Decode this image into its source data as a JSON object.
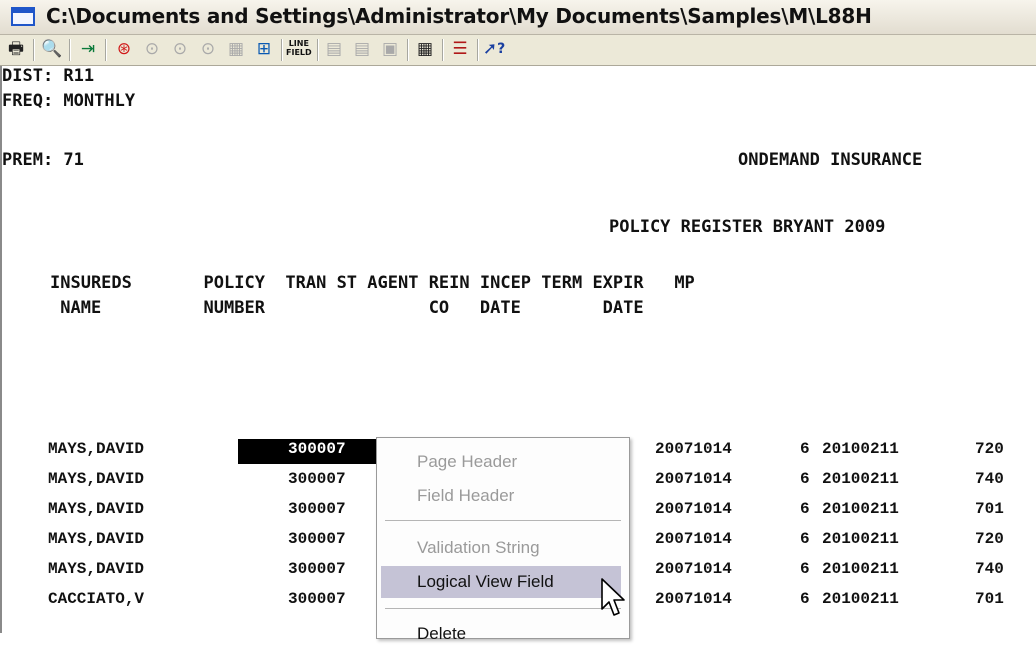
{
  "window": {
    "title": "C:\\Documents and Settings\\Administrator\\My Documents\\Samples\\M\\L88H"
  },
  "toolbar": {
    "line_field_top": "LINE",
    "line_field_bottom": "FIELD",
    "help_glyph": "?"
  },
  "report": {
    "dist": "DIST: R11",
    "freq": "FREQ: MONTHLY",
    "prem": "PREM: 71",
    "company": "ONDEMAND INSURANCE",
    "register_title": "POLICY REGISTER BRYANT 2009",
    "columns_line1": "INSUREDS       POLICY  TRAN ST AGENT REIN INCEP TERM EXPIR   MP",
    "columns_line2": " NAME          NUMBER                CO   DATE        DATE",
    "rows": [
      {
        "name": "MAYS,DAVID",
        "policy": "300007",
        "incep": "20071014",
        "term": "6",
        "expir": "20100211",
        "mp": "720"
      },
      {
        "name": "MAYS,DAVID",
        "policy": "300007",
        "incep": "20071014",
        "term": "6",
        "expir": "20100211",
        "mp": "740"
      },
      {
        "name": "MAYS,DAVID",
        "policy": "300007",
        "incep": "20071014",
        "term": "6",
        "expir": "20100211",
        "mp": "701"
      },
      {
        "name": "MAYS,DAVID",
        "policy": "300007",
        "incep": "20071014",
        "term": "6",
        "expir": "20100211",
        "mp": "720"
      },
      {
        "name": "MAYS,DAVID",
        "policy": "300007",
        "incep": "20071014",
        "term": "6",
        "expir": "20100211",
        "mp": "740"
      },
      {
        "name": "CACCIATO,V",
        "policy": "300007",
        "incep": "20071014",
        "term": "6",
        "expir": "20100211",
        "mp": "701"
      }
    ],
    "selected_row": 0
  },
  "context_menu": {
    "items": [
      {
        "label": "Page Header",
        "enabled": false
      },
      {
        "label": "Field Header",
        "enabled": false
      },
      {
        "label": "Validation String",
        "enabled": false
      },
      {
        "label": "Logical View Field",
        "enabled": true,
        "highlighted": true
      },
      {
        "label": "Delete",
        "enabled": true
      }
    ]
  }
}
